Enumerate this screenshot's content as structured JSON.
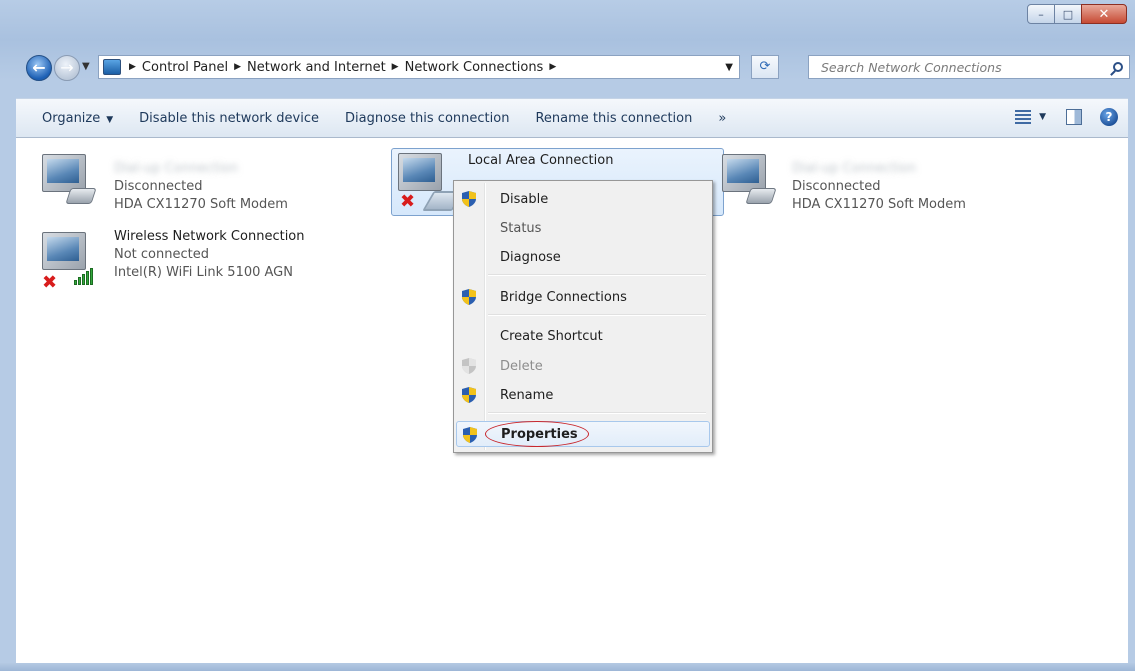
{
  "window": {
    "controls": {
      "minimize": "–",
      "maximize": "□",
      "close": "✕"
    }
  },
  "address": {
    "breadcrumbs": [
      "Control Panel",
      "Network and Internet",
      "Network Connections"
    ],
    "search_placeholder": "Search Network Connections"
  },
  "toolbar": {
    "organize": "Organize",
    "disable": "Disable this network device",
    "diagnose": "Diagnose this connection",
    "rename": "Rename this connection",
    "more": "»"
  },
  "connections": [
    {
      "name": "",
      "status": "Disconnected",
      "device": "HDA CX11270 Soft Modem"
    },
    {
      "name": "Wireless Network Connection",
      "status": "Not connected",
      "device": "Intel(R) WiFi Link 5100 AGN"
    },
    {
      "name": "Local Area Connection",
      "status": ""
    },
    {
      "name": "",
      "status": "Disconnected",
      "device": "HDA CX11270 Soft Modem"
    }
  ],
  "context_menu": {
    "items": [
      {
        "label": "Disable",
        "shield": true,
        "disabled": false
      },
      {
        "label": "Status",
        "shield": false,
        "disabled": false
      },
      {
        "label": "Diagnose",
        "shield": false,
        "disabled": false
      },
      {
        "label": "Bridge Connections",
        "shield": true,
        "disabled": false
      },
      {
        "label": "Create Shortcut",
        "shield": false,
        "disabled": false
      },
      {
        "label": "Delete",
        "shield": true,
        "disabled": true
      },
      {
        "label": "Rename",
        "shield": true,
        "disabled": false
      },
      {
        "label": "Properties",
        "shield": true,
        "disabled": false,
        "highlighted": true
      }
    ]
  },
  "colors": {
    "accent": "#1c5fb4",
    "highlight_circle": "#c8282e"
  }
}
